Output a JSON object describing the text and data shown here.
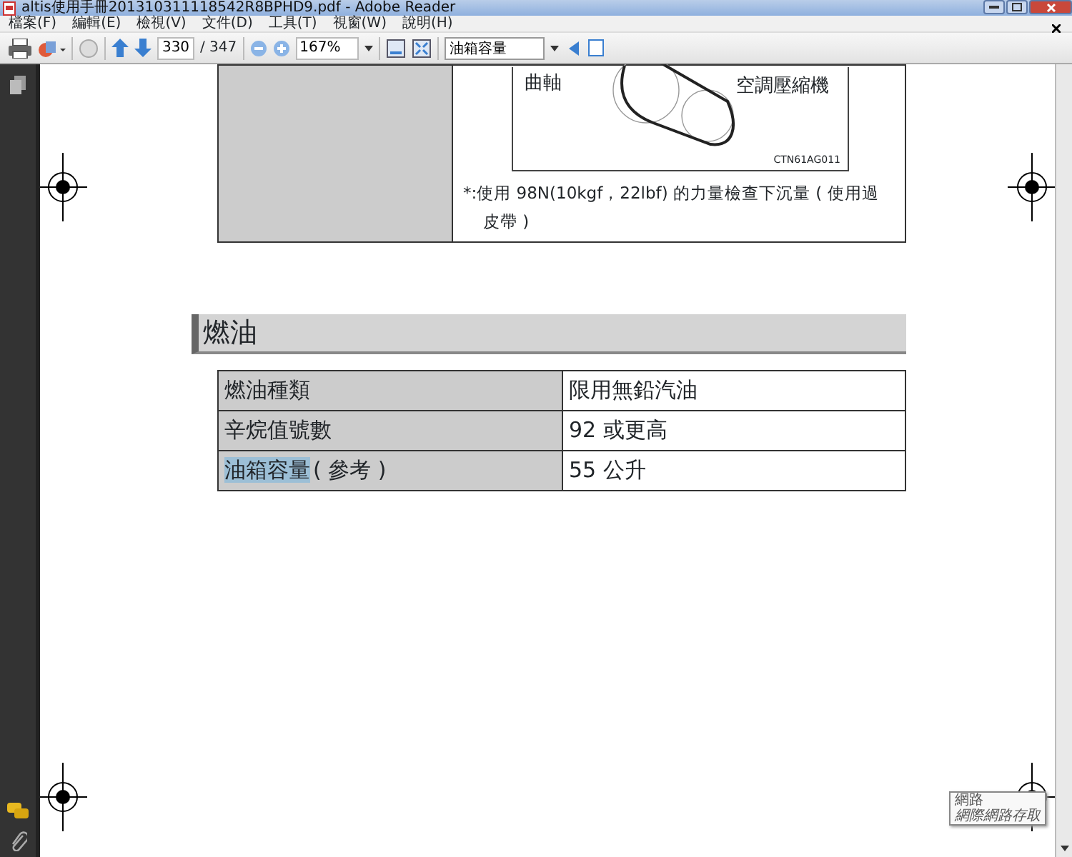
{
  "window": {
    "title": "altis使用手冊201310311118542R8BPHD9.pdf - Adobe Reader"
  },
  "menu": [
    "檔案(F)",
    "編輯(E)",
    "檢視(V)",
    "文件(D)",
    "工具(T)",
    "視窗(W)",
    "說明(H)"
  ],
  "toolbar": {
    "page": "330",
    "page_count": "/ 347",
    "zoom": "167%",
    "search": "油箱容量"
  },
  "document": {
    "belt_figure": {
      "labels": [
        "曲軸",
        "空調壓縮機"
      ],
      "code": "CTN61AG011"
    },
    "note": "*:使用 98N(10kgf，22lbf) 的力量檢查下沉量 ( 使用過皮帶 )",
    "section_heading": "燃油",
    "table": {
      "rows": [
        {
          "label": [
            {
              "text": "燃油種類",
              "selected": false
            }
          ],
          "value": "限用無鉛汽油"
        },
        {
          "label": [
            {
              "text": "辛烷值號數",
              "selected": false
            }
          ],
          "value": "92 或更高"
        },
        {
          "label": [
            {
              "text": "油箱容量",
              "selected": true
            },
            {
              "text": "( 參考 )",
              "selected": false
            }
          ],
          "value": "55 公升"
        }
      ]
    }
  },
  "tooltip": {
    "title": "網路",
    "text": "網際網路存取"
  }
}
